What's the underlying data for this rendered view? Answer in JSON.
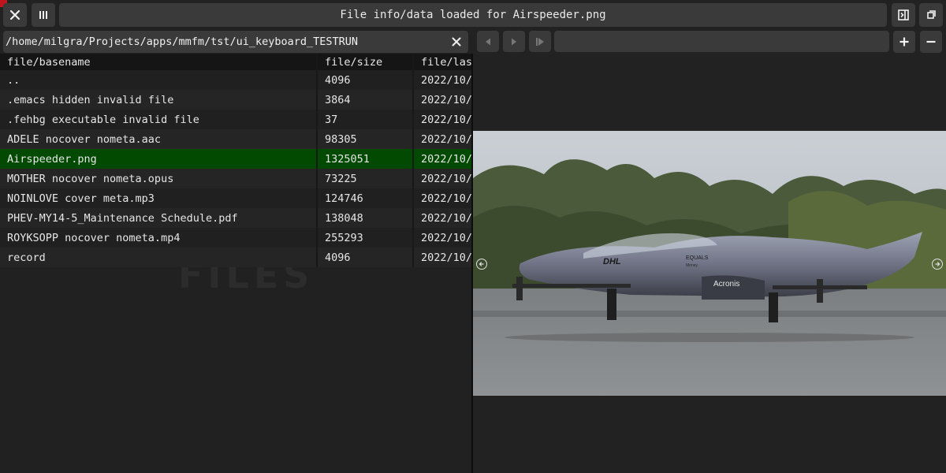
{
  "window": {
    "title": "File info/data loaded for Airspeeder.png"
  },
  "toolbar": {
    "close_icon": "close-icon",
    "columns_icon": "columns-icon",
    "panel_icon": "side-panel-icon",
    "fullscreen_icon": "fullscreen-icon",
    "zoom_in_icon": "plus-icon",
    "zoom_out_icon": "minus-icon"
  },
  "path_bar": {
    "value": "/home/milgra/Projects/apps/mmfm/tst/ui_keyboard_TESTRUN",
    "clear_icon": "clear-icon"
  },
  "media_controls": [
    "previous-icon",
    "play-icon",
    "next-icon"
  ],
  "file_table": {
    "columns": [
      "file/basename",
      "file/size",
      "file/last_access"
    ],
    "rows": [
      {
        "name": "..",
        "size": "4096",
        "date": "2022/10/",
        "selected": false
      },
      {
        "name": ".emacs hidden invalid file",
        "size": "3864",
        "date": "2022/10/",
        "selected": false
      },
      {
        "name": ".fehbg executable invalid file",
        "size": "37",
        "date": "2022/10/",
        "selected": false
      },
      {
        "name": "ADELE nocover nometa.aac",
        "size": "98305",
        "date": "2022/10/",
        "selected": false
      },
      {
        "name": "Airspeeder.png",
        "size": "1325051",
        "date": "2022/10/",
        "selected": true
      },
      {
        "name": "MOTHER nocover nometa.opus",
        "size": "73225",
        "date": "2022/10/",
        "selected": false
      },
      {
        "name": "NOINLOVE cover meta.mp3",
        "size": "124746",
        "date": "2022/10/",
        "selected": false
      },
      {
        "name": "PHEV-MY14-5_Maintenance Schedule.pdf",
        "size": "138048",
        "date": "2022/10/",
        "selected": false
      },
      {
        "name": "ROYKSOPP nocover nometa.mp4",
        "size": "255293",
        "date": "2022/10/",
        "selected": false
      },
      {
        "name": "record",
        "size": "4096",
        "date": "2022/10/",
        "selected": false
      }
    ],
    "watermark": "FILES"
  },
  "preview": {
    "image_texts": [
      "DHL",
      "EQUALS",
      "Money",
      "Acronis"
    ],
    "prev_icon": "arrow-left-circle-icon",
    "next_icon": "arrow-right-circle-icon"
  },
  "colors": {
    "selected_row": "#024a02",
    "accent_red": "#c0151e",
    "button_bg": "#3a3a3a"
  }
}
